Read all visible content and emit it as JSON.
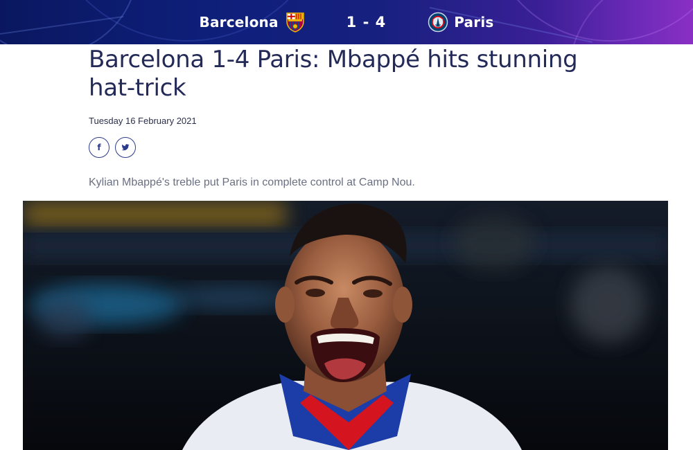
{
  "match": {
    "home_team": "Barcelona",
    "away_team": "Paris",
    "score": "1 - 4",
    "home_crest_icon": "barcelona-crest-icon",
    "away_crest_icon": "psg-crest-icon"
  },
  "article": {
    "headline": "Barcelona 1-4 Paris: Mbappé hits stunning hat-trick",
    "date": "Tuesday 16 February 2021",
    "share": [
      {
        "icon": "facebook-icon",
        "glyph": "f"
      },
      {
        "icon": "twitter-icon"
      }
    ],
    "summary": "Kylian Mbappé's treble put Paris in complete control at Camp Nou."
  },
  "colors": {
    "headline": "#232a57",
    "banner_start": "#0a1760",
    "banner_end": "#8a2fc4",
    "share_border": "#2b3a8c",
    "summary": "#6b6f82"
  }
}
